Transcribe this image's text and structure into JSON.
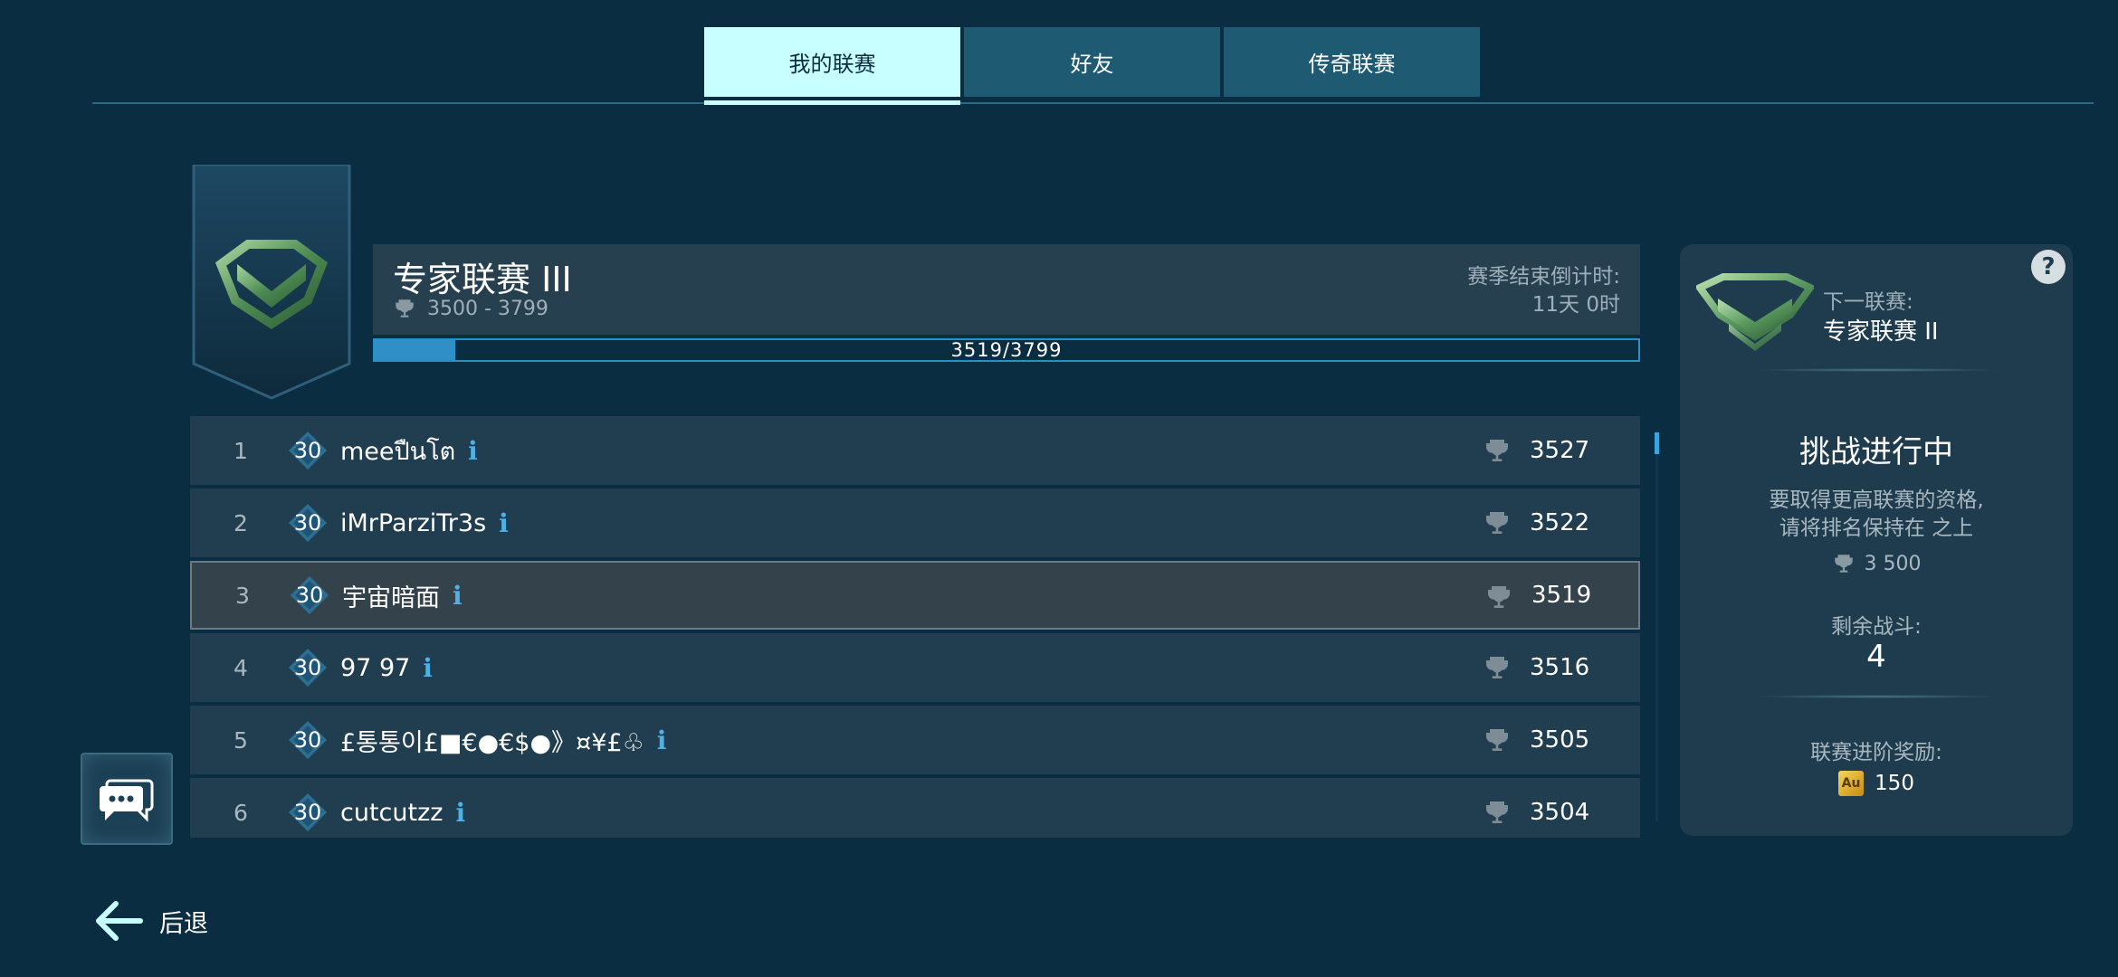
{
  "tabs": [
    {
      "label": "我的联赛",
      "active": true
    },
    {
      "label": "好友",
      "active": false
    },
    {
      "label": "传奇联赛",
      "active": false
    }
  ],
  "league": {
    "title": "专家联赛 III",
    "range": "3500 - 3799",
    "season_label": "赛季结束倒计时:",
    "season_value": "11天 0时",
    "progress_text": "3519/3799",
    "progress_current": 3519,
    "progress_min": 3500,
    "progress_max": 3799
  },
  "leaderboard": [
    {
      "rank": "1",
      "level": "30",
      "name": "meeปืนโต",
      "score": "3527",
      "highlight": false
    },
    {
      "rank": "2",
      "level": "30",
      "name": "iMrParziTr3s",
      "score": "3522",
      "highlight": false
    },
    {
      "rank": "3",
      "level": "30",
      "name": "宇宙暗面",
      "score": "3519",
      "highlight": true
    },
    {
      "rank": "4",
      "level": "30",
      "name": "97 97",
      "score": "3516",
      "highlight": false
    },
    {
      "rank": "5",
      "level": "30",
      "name": "£통통이£■€●€$●》¤¥£♧",
      "score": "3505",
      "highlight": false
    },
    {
      "rank": "6",
      "level": "30",
      "name": "cutcutzz",
      "score": "3504",
      "highlight": false
    }
  ],
  "panel": {
    "next_label": "下一联赛:",
    "next_name": "专家联赛 II",
    "challenge_title": "挑战进行中",
    "challenge_desc_line1": "要取得更高联赛的资格,",
    "challenge_desc_line2": "请将排名保持在 之上",
    "challenge_req": "3 500",
    "remain_label": "剩余战斗:",
    "remain_value": "4",
    "reward_label": "联赛进阶奖励:",
    "reward_icon_text": "Au",
    "reward_value": "150",
    "help": "?"
  },
  "back_label": "后退",
  "icons": {
    "info": "i",
    "trophy": "trophy-icon",
    "chat": "chat-icon",
    "back": "back-arrow-icon"
  },
  "colors": {
    "background": "#0b2d42",
    "tab_active": "#c8ffff",
    "tab": "#1f5a73",
    "accent": "#2f8fc6",
    "info": "#4fb0e6"
  }
}
